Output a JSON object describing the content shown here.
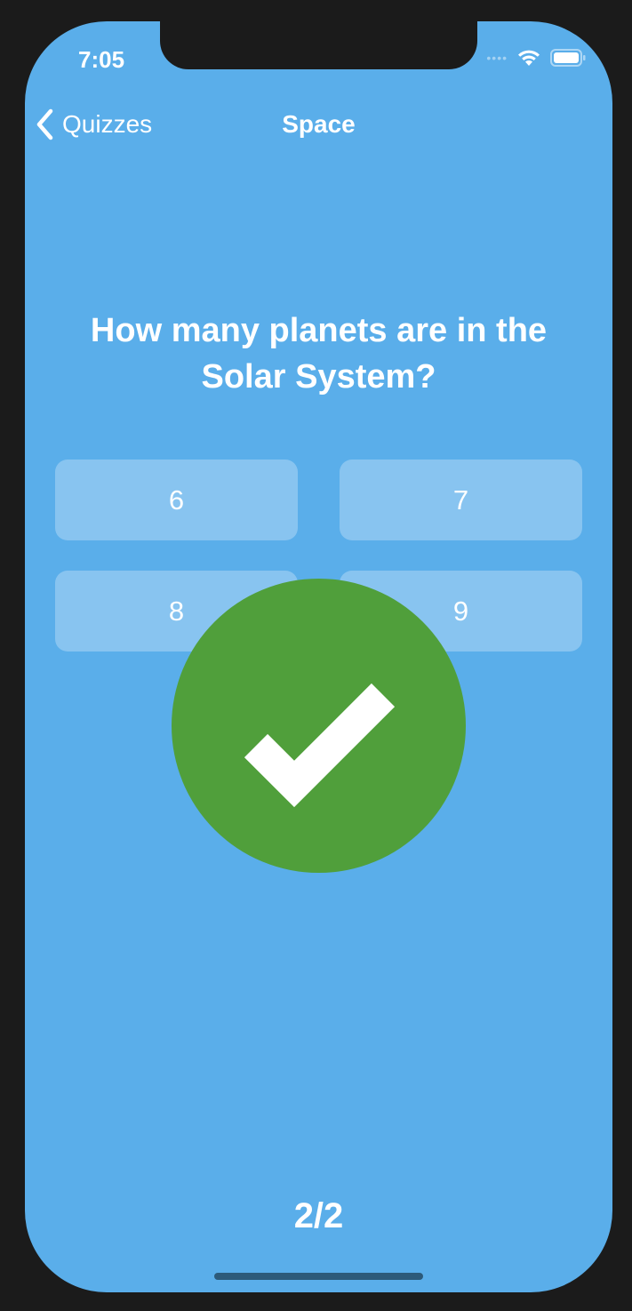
{
  "status_bar": {
    "time": "7:05",
    "signal_icon": "signal-dots-icon",
    "wifi_icon": "wifi-icon",
    "battery_icon": "battery-icon"
  },
  "nav": {
    "back_label": "Quizzes",
    "back_icon": "chevron-left-icon",
    "title": "Space"
  },
  "quiz": {
    "question": "How many planets are in the Solar System?",
    "answers": [
      "6",
      "7",
      "8",
      "9"
    ],
    "result_icon": "checkmark-icon",
    "progress": "2/2"
  },
  "colors": {
    "background": "#5aaeea",
    "answer_fill": "rgba(255,255,255,0.28)",
    "correct_badge": "#509f3b",
    "text": "#ffffff"
  }
}
